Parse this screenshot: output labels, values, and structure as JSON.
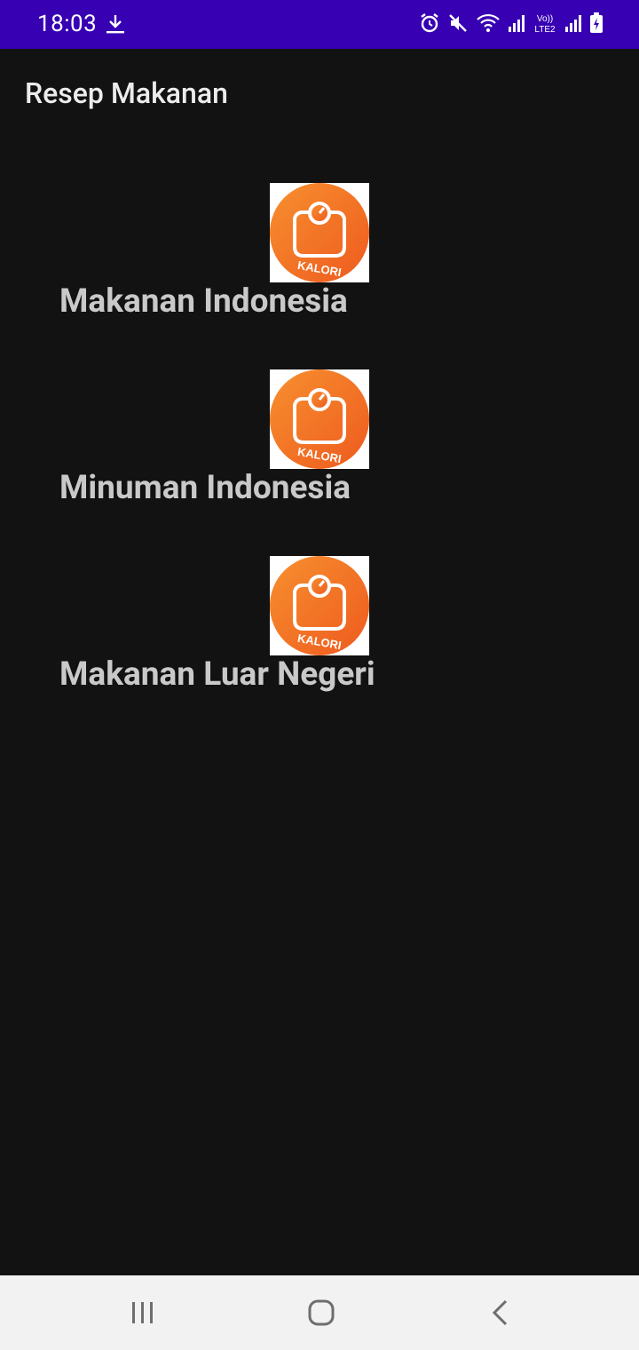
{
  "status_bar": {
    "time": "18:03",
    "icons": [
      "download-icon",
      "alarm-icon",
      "mute-icon",
      "wifi-icon",
      "signal-icon",
      "volte-lte-icon",
      "signal-icon",
      "battery-charging-icon"
    ],
    "volte_text_top": "Vo))",
    "volte_text_bottom": "LTE2"
  },
  "app_bar": {
    "title": "Resep Makanan"
  },
  "menu": {
    "items": [
      {
        "label": "Makanan Indonesia",
        "icon_text": "KALORI"
      },
      {
        "label": "Minuman Indonesia",
        "icon_text": "KALORI"
      },
      {
        "label": "Makanan Luar Negeri",
        "icon_text": "KALORI"
      }
    ],
    "icon_colors": {
      "start": "#f7902f",
      "end": "#ee5a1e"
    }
  },
  "nav_bar": {
    "buttons": [
      "recents-icon",
      "home-icon",
      "back-icon"
    ]
  }
}
